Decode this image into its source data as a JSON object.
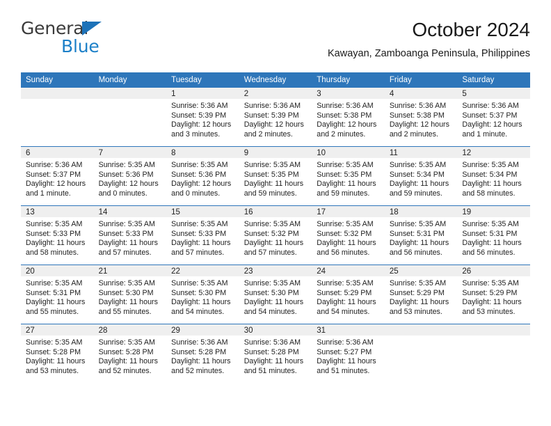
{
  "brand": {
    "name_top": "General",
    "name_bottom": "Blue",
    "accent_color": "#1d80c8",
    "triangle_color": "#1d72b8"
  },
  "header": {
    "title": "October 2024",
    "subtitle": "Kawayan, Zamboanga Peninsula, Philippines"
  },
  "theme": {
    "header_row_bg": "#2e76ba",
    "header_row_text": "#ffffff",
    "daynum_strip_bg": "#efefef",
    "grid_line": "#2e76ba",
    "body_text": "#222222"
  },
  "weekday_headers": [
    "Sunday",
    "Monday",
    "Tuesday",
    "Wednesday",
    "Thursday",
    "Friday",
    "Saturday"
  ],
  "labels": {
    "sunrise_prefix": "Sunrise:",
    "sunset_prefix": "Sunset:",
    "daylight_prefix": "Daylight:"
  },
  "weeks": [
    [
      {
        "day": "",
        "empty": true
      },
      {
        "day": "",
        "empty": true
      },
      {
        "day": "1",
        "sunrise": "Sunrise: 5:36 AM",
        "sunset": "Sunset: 5:39 PM",
        "daylight": "Daylight: 12 hours and 3 minutes."
      },
      {
        "day": "2",
        "sunrise": "Sunrise: 5:36 AM",
        "sunset": "Sunset: 5:39 PM",
        "daylight": "Daylight: 12 hours and 2 minutes."
      },
      {
        "day": "3",
        "sunrise": "Sunrise: 5:36 AM",
        "sunset": "Sunset: 5:38 PM",
        "daylight": "Daylight: 12 hours and 2 minutes."
      },
      {
        "day": "4",
        "sunrise": "Sunrise: 5:36 AM",
        "sunset": "Sunset: 5:38 PM",
        "daylight": "Daylight: 12 hours and 2 minutes."
      },
      {
        "day": "5",
        "sunrise": "Sunrise: 5:36 AM",
        "sunset": "Sunset: 5:37 PM",
        "daylight": "Daylight: 12 hours and 1 minute."
      }
    ],
    [
      {
        "day": "6",
        "sunrise": "Sunrise: 5:36 AM",
        "sunset": "Sunset: 5:37 PM",
        "daylight": "Daylight: 12 hours and 1 minute."
      },
      {
        "day": "7",
        "sunrise": "Sunrise: 5:35 AM",
        "sunset": "Sunset: 5:36 PM",
        "daylight": "Daylight: 12 hours and 0 minutes."
      },
      {
        "day": "8",
        "sunrise": "Sunrise: 5:35 AM",
        "sunset": "Sunset: 5:36 PM",
        "daylight": "Daylight: 12 hours and 0 minutes."
      },
      {
        "day": "9",
        "sunrise": "Sunrise: 5:35 AM",
        "sunset": "Sunset: 5:35 PM",
        "daylight": "Daylight: 11 hours and 59 minutes."
      },
      {
        "day": "10",
        "sunrise": "Sunrise: 5:35 AM",
        "sunset": "Sunset: 5:35 PM",
        "daylight": "Daylight: 11 hours and 59 minutes."
      },
      {
        "day": "11",
        "sunrise": "Sunrise: 5:35 AM",
        "sunset": "Sunset: 5:34 PM",
        "daylight": "Daylight: 11 hours and 59 minutes."
      },
      {
        "day": "12",
        "sunrise": "Sunrise: 5:35 AM",
        "sunset": "Sunset: 5:34 PM",
        "daylight": "Daylight: 11 hours and 58 minutes."
      }
    ],
    [
      {
        "day": "13",
        "sunrise": "Sunrise: 5:35 AM",
        "sunset": "Sunset: 5:33 PM",
        "daylight": "Daylight: 11 hours and 58 minutes."
      },
      {
        "day": "14",
        "sunrise": "Sunrise: 5:35 AM",
        "sunset": "Sunset: 5:33 PM",
        "daylight": "Daylight: 11 hours and 57 minutes."
      },
      {
        "day": "15",
        "sunrise": "Sunrise: 5:35 AM",
        "sunset": "Sunset: 5:33 PM",
        "daylight": "Daylight: 11 hours and 57 minutes."
      },
      {
        "day": "16",
        "sunrise": "Sunrise: 5:35 AM",
        "sunset": "Sunset: 5:32 PM",
        "daylight": "Daylight: 11 hours and 57 minutes."
      },
      {
        "day": "17",
        "sunrise": "Sunrise: 5:35 AM",
        "sunset": "Sunset: 5:32 PM",
        "daylight": "Daylight: 11 hours and 56 minutes."
      },
      {
        "day": "18",
        "sunrise": "Sunrise: 5:35 AM",
        "sunset": "Sunset: 5:31 PM",
        "daylight": "Daylight: 11 hours and 56 minutes."
      },
      {
        "day": "19",
        "sunrise": "Sunrise: 5:35 AM",
        "sunset": "Sunset: 5:31 PM",
        "daylight": "Daylight: 11 hours and 56 minutes."
      }
    ],
    [
      {
        "day": "20",
        "sunrise": "Sunrise: 5:35 AM",
        "sunset": "Sunset: 5:31 PM",
        "daylight": "Daylight: 11 hours and 55 minutes."
      },
      {
        "day": "21",
        "sunrise": "Sunrise: 5:35 AM",
        "sunset": "Sunset: 5:30 PM",
        "daylight": "Daylight: 11 hours and 55 minutes."
      },
      {
        "day": "22",
        "sunrise": "Sunrise: 5:35 AM",
        "sunset": "Sunset: 5:30 PM",
        "daylight": "Daylight: 11 hours and 54 minutes."
      },
      {
        "day": "23",
        "sunrise": "Sunrise: 5:35 AM",
        "sunset": "Sunset: 5:30 PM",
        "daylight": "Daylight: 11 hours and 54 minutes."
      },
      {
        "day": "24",
        "sunrise": "Sunrise: 5:35 AM",
        "sunset": "Sunset: 5:29 PM",
        "daylight": "Daylight: 11 hours and 54 minutes."
      },
      {
        "day": "25",
        "sunrise": "Sunrise: 5:35 AM",
        "sunset": "Sunset: 5:29 PM",
        "daylight": "Daylight: 11 hours and 53 minutes."
      },
      {
        "day": "26",
        "sunrise": "Sunrise: 5:35 AM",
        "sunset": "Sunset: 5:29 PM",
        "daylight": "Daylight: 11 hours and 53 minutes."
      }
    ],
    [
      {
        "day": "27",
        "sunrise": "Sunrise: 5:35 AM",
        "sunset": "Sunset: 5:28 PM",
        "daylight": "Daylight: 11 hours and 53 minutes."
      },
      {
        "day": "28",
        "sunrise": "Sunrise: 5:35 AM",
        "sunset": "Sunset: 5:28 PM",
        "daylight": "Daylight: 11 hours and 52 minutes."
      },
      {
        "day": "29",
        "sunrise": "Sunrise: 5:36 AM",
        "sunset": "Sunset: 5:28 PM",
        "daylight": "Daylight: 11 hours and 52 minutes."
      },
      {
        "day": "30",
        "sunrise": "Sunrise: 5:36 AM",
        "sunset": "Sunset: 5:28 PM",
        "daylight": "Daylight: 11 hours and 51 minutes."
      },
      {
        "day": "31",
        "sunrise": "Sunrise: 5:36 AM",
        "sunset": "Sunset: 5:27 PM",
        "daylight": "Daylight: 11 hours and 51 minutes."
      },
      {
        "day": "",
        "empty": true
      },
      {
        "day": "",
        "empty": true
      }
    ]
  ]
}
